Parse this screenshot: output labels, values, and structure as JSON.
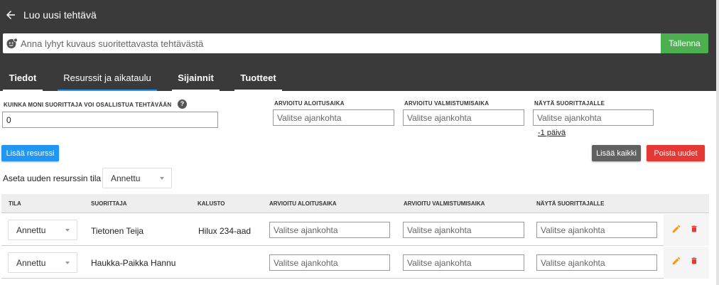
{
  "header": {
    "title": "Luo uusi tehtävä",
    "description_placeholder": "Anna lyhyt kuvaus suoritettavasta tehtävästä",
    "save_label": "Tallenna"
  },
  "tabs": [
    {
      "label": "Tiedot",
      "active": false
    },
    {
      "label": "Resurssit ja aikataulu",
      "active": true
    },
    {
      "label": "Sijainnit",
      "active": false
    },
    {
      "label": "Tuotteet",
      "active": false
    }
  ],
  "form": {
    "count_label": "KUINKA MONI SUORITTAJA VOI OSALLISTUA TEHTÄVÄÄN",
    "count_value": "0",
    "start_label": "ARVIOITU ALOITUSAIKA",
    "end_label": "ARVIOITU VALMISTUMISAIKA",
    "show_label": "NÄYTÄ SUORITTAJALLE",
    "date_placeholder": "Valitse ajankohta",
    "show_link": "-1 päivä"
  },
  "actions": {
    "add_resource": "Lisää resurssi",
    "add_all": "Lisää kaikki",
    "remove_new": "Poista uudet"
  },
  "new_resource": {
    "label": "Aseta uuden resurssin tila",
    "status": "Annettu"
  },
  "table": {
    "columns": [
      "TILA",
      "SUORITTAJA",
      "KALUSTO",
      "ARVIOITU ALOITUSAIKA",
      "ARVIOITU VALMISTUMISAIKA",
      "NÄYTÄ SUORITTAJALLE"
    ],
    "rows": [
      {
        "status": "Annettu",
        "worker": "Tietonen Teija",
        "equipment": "Hilux 234-aad",
        "placeholder": "Valitse ajankohta"
      },
      {
        "status": "Annettu",
        "worker": "Haukka-Paikka Hannu",
        "equipment": "",
        "placeholder": "Valitse ajankohta"
      }
    ]
  },
  "colors": {
    "topbar": "#3a3a3a",
    "save": "#4caf50",
    "tab_active": "#2196f3",
    "add_resource": "#2196f3",
    "add_all": "#616161",
    "remove": "#e53935",
    "edit_icon": "#ff9800",
    "trash_icon": "#e53935"
  }
}
